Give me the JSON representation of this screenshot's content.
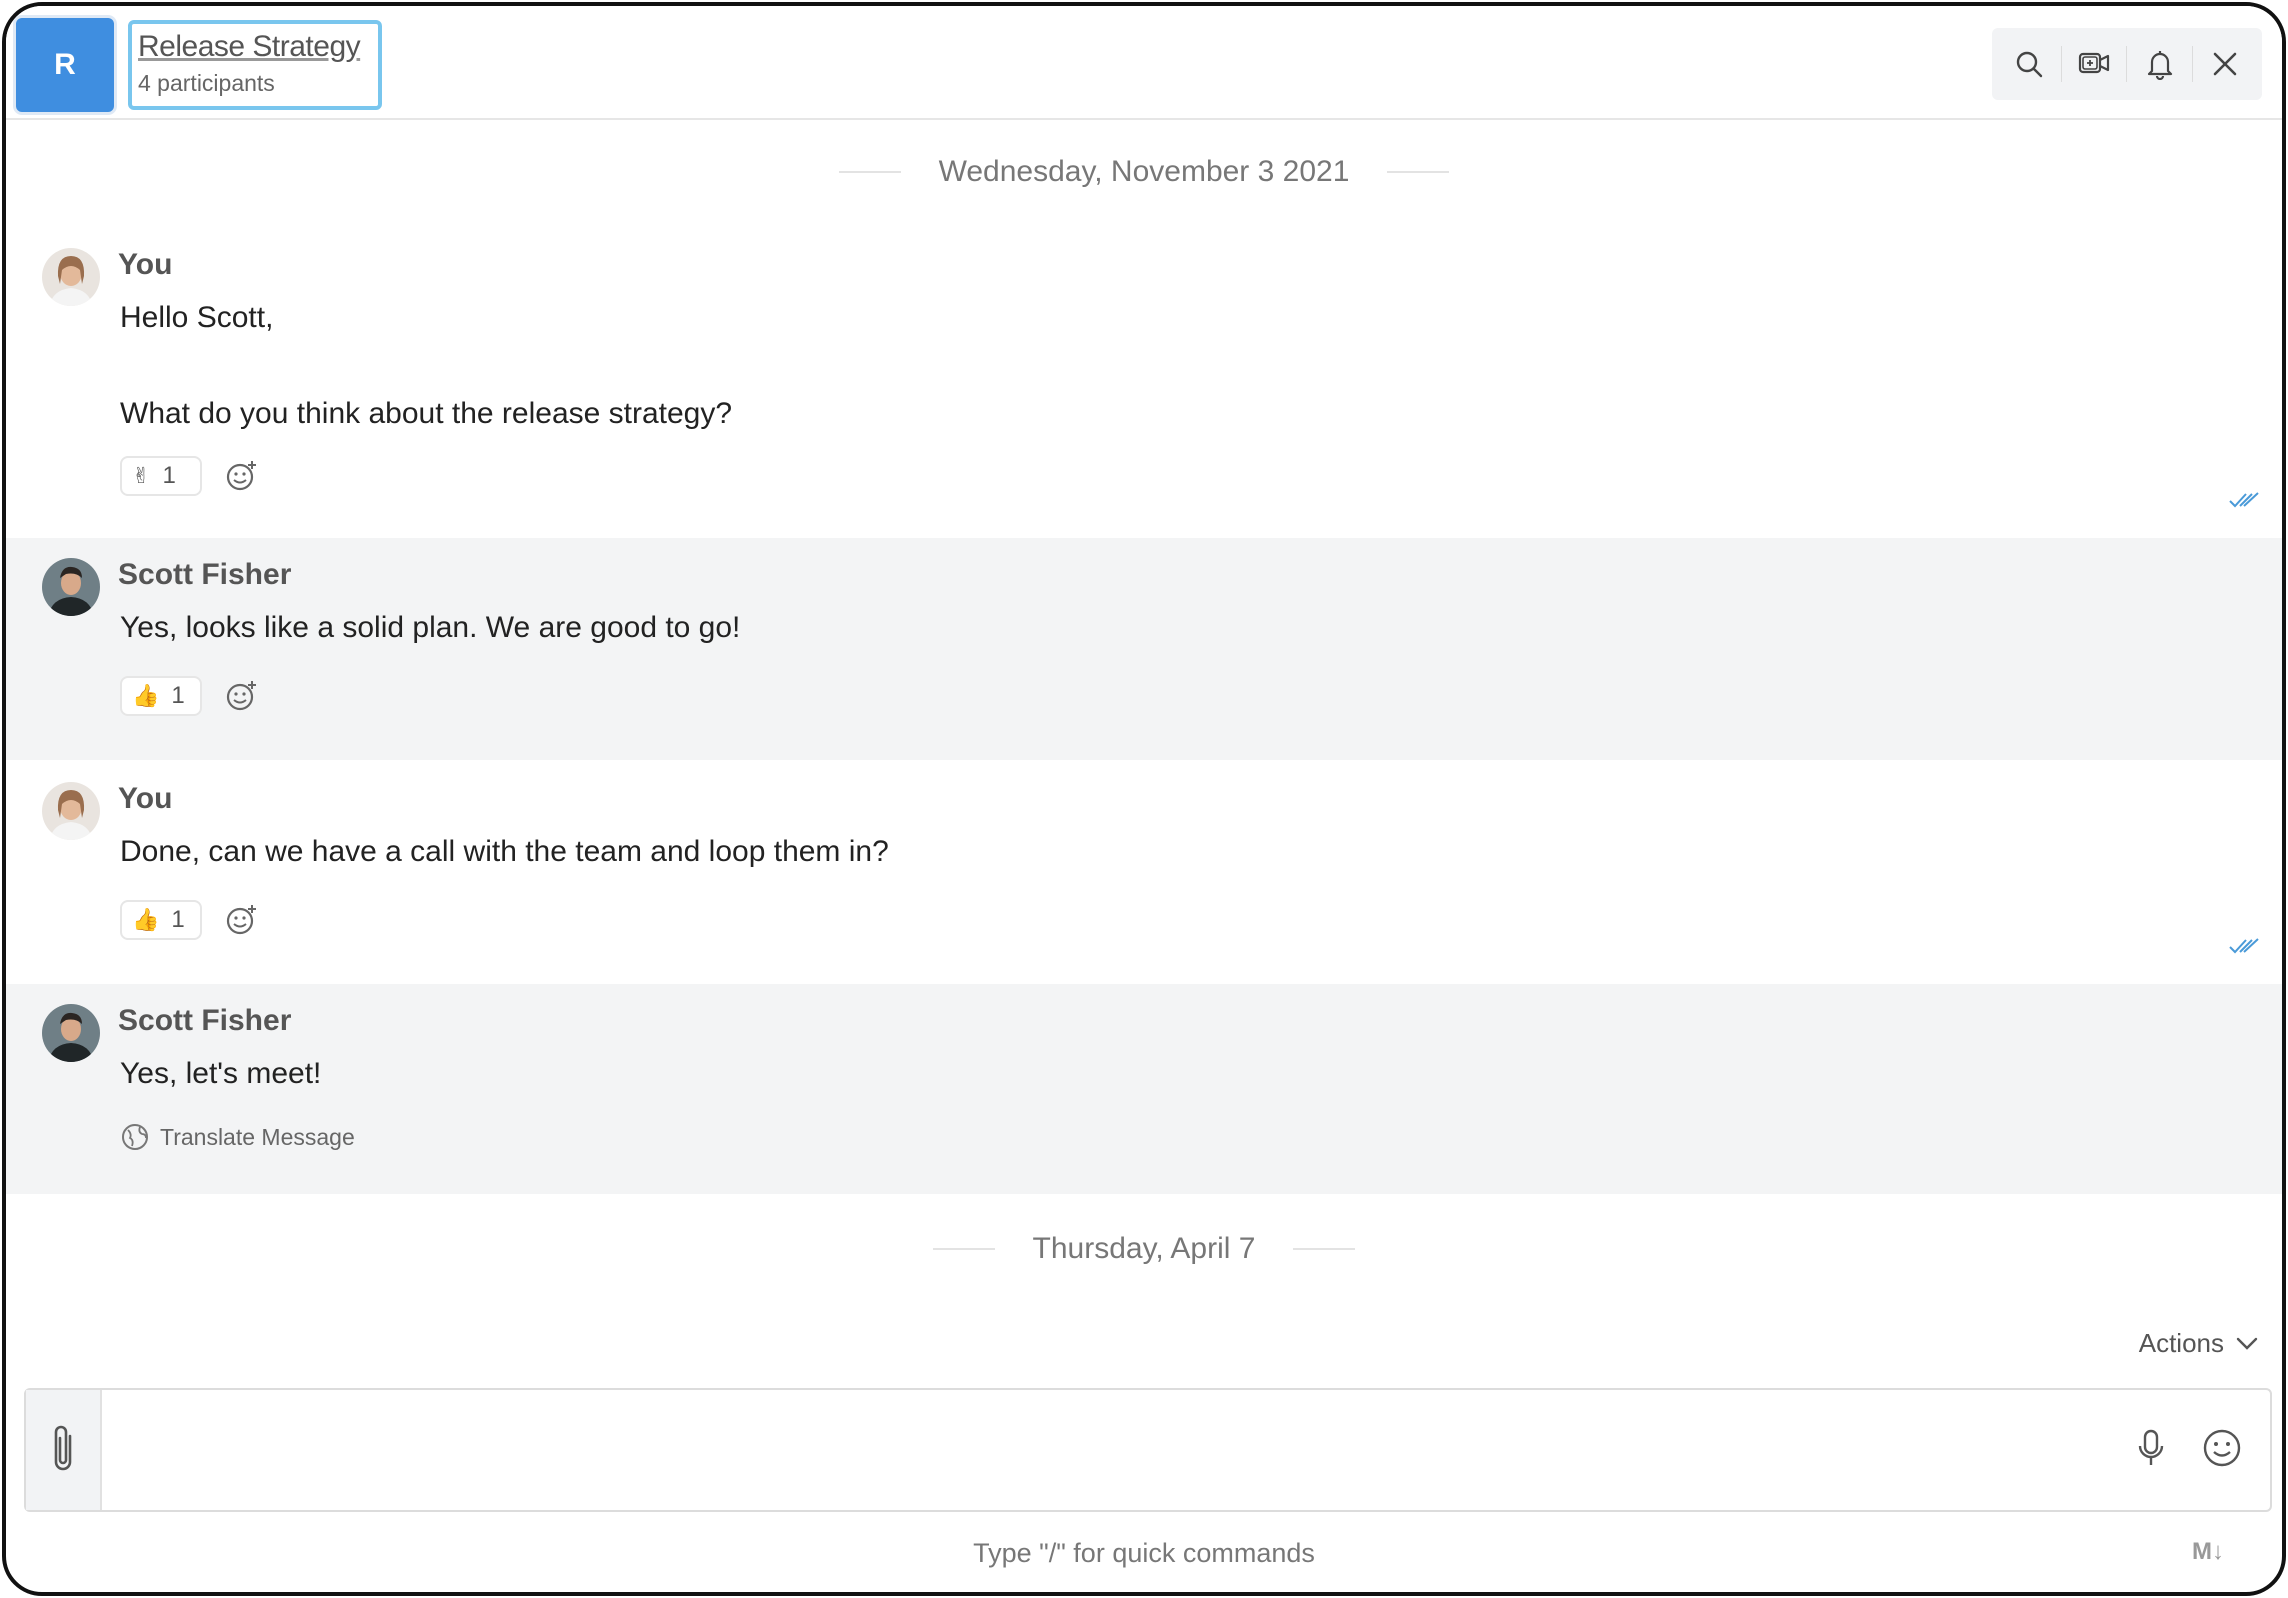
{
  "header": {
    "room_initial": "R",
    "room_title": "Release Strategy",
    "participants": "4 participants",
    "icons": [
      "search-icon",
      "video-call-icon",
      "notification-bell-icon",
      "close-icon"
    ]
  },
  "dates": {
    "first": "Wednesday, November 3 2021",
    "second": "Thursday, April 7"
  },
  "messages": [
    {
      "author": "You",
      "lines": [
        "Hello Scott,",
        "What do you think about the release strategy?"
      ],
      "reaction": {
        "emoji": "✌",
        "count": "1"
      },
      "read": true
    },
    {
      "author": "Scott Fisher",
      "lines": [
        "Yes, looks like a solid plan. We are good to go!"
      ],
      "reaction": {
        "emoji": "👍",
        "count": "1"
      },
      "read": false
    },
    {
      "author": "You",
      "lines": [
        "Done, can we have a call with the team and loop them in?"
      ],
      "reaction": {
        "emoji": "👍",
        "count": "1"
      },
      "read": true
    },
    {
      "author": "Scott Fisher",
      "lines": [
        "Yes, let's meet!"
      ],
      "translate_label": "Translate Message"
    }
  ],
  "composer": {
    "actions_label": "Actions",
    "placeholder": "",
    "hint": "Type \"/\" for quick commands",
    "markdown_badge": "M↓"
  },
  "colors": {
    "accent": "#3f8ee0",
    "focus_border": "#79c6ee",
    "alt_row": "#f3f4f5",
    "read_receipt": "#4a9ad8"
  }
}
